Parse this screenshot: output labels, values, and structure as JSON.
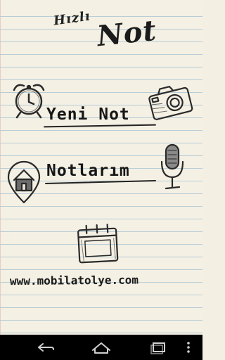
{
  "app": {
    "title_small": "Hızlı",
    "title_big": "Not"
  },
  "menu": {
    "new_note": "Yeni Not",
    "my_notes": "Notlarım"
  },
  "footer": {
    "website": "www.mobilatolye.com"
  },
  "icons": {
    "alarm": "alarm-clock-icon",
    "camera": "camera-icon",
    "home": "home-icon",
    "microphone": "microphone-icon",
    "calendar": "calendar-icon"
  },
  "navbar": {
    "back": "back-icon",
    "home": "home-icon",
    "recents": "recents-icon",
    "menu": "menu-icon"
  },
  "colors": {
    "paper": "#f4f0e4",
    "ruled_line": "#b8cdd6",
    "ink": "#1a1a1a",
    "navbar": "#000000"
  }
}
